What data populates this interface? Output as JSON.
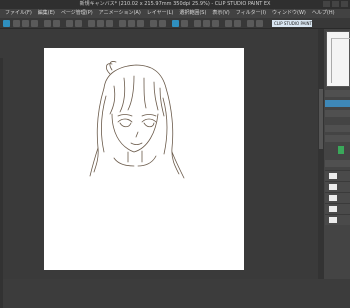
{
  "window": {
    "title": "新規キャンバス* (210.02 x 215.97mm 350dpi 25.9%) - CLIP STUDIO PAINT EX"
  },
  "menu": {
    "items": [
      "ファイル(F)",
      "編集(E)",
      "ページ管理(P)",
      "アニメーション(A)",
      "レイヤー(L)",
      "選択範囲(S)",
      "表示(V)",
      "フィルター(I)",
      "ウィンドウ(W)",
      "ヘルプ(H)"
    ]
  },
  "commandbar": {
    "dropdown_label": "CLIP STUDIO PAINT"
  },
  "colors": {
    "accent": "#2f8fbf",
    "swatch": "#3aa85a",
    "canvas": "#ffffff",
    "workspace": "#3a3a3a"
  }
}
